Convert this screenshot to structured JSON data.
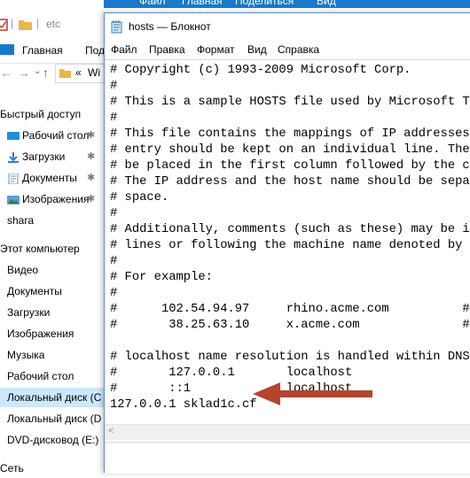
{
  "explorer": {
    "title_path": "etc",
    "ribbon_tabs": [
      "Файл",
      "Главная",
      "Поделиться",
      "Вид"
    ],
    "tabs": [
      "Главная",
      "Под"
    ],
    "address_fragment": "Wi",
    "address_prefix": "«",
    "nav": {
      "quick_access": "Быстрый доступ",
      "quick_items": [
        {
          "label": "Рабочий стол",
          "icon": "desktop-icon"
        },
        {
          "label": "Загрузки",
          "icon": "downloads-icon"
        },
        {
          "label": "Документы",
          "icon": "documents-icon"
        },
        {
          "label": "Изображения",
          "icon": "pictures-icon"
        },
        {
          "label": "shara",
          "icon": "folder-icon"
        }
      ],
      "this_pc": "Этот компьютер",
      "pc_items": [
        {
          "label": "Видео",
          "icon": "video-icon"
        },
        {
          "label": "Документы",
          "icon": "documents-icon"
        },
        {
          "label": "Загрузки",
          "icon": "downloads-icon"
        },
        {
          "label": "Изображения",
          "icon": "pictures-icon"
        },
        {
          "label": "Музыка",
          "icon": "music-icon"
        },
        {
          "label": "Рабочий стол",
          "icon": "desktop-icon"
        },
        {
          "label": "Локальный диск (C",
          "icon": "drive-icon"
        },
        {
          "label": "Локальный диск (D",
          "icon": "drive-icon"
        },
        {
          "label": "DVD-дисковод (E:)",
          "icon": "dvd-icon"
        }
      ],
      "network": "Сеть"
    }
  },
  "notepad": {
    "title": "hosts — Блокнот",
    "menu": [
      "Файл",
      "Правка",
      "Формат",
      "Вид",
      "Справка"
    ],
    "content": "# Copyright (c) 1993-2009 Microsoft Corp.\n#\n# This is a sample HOSTS file used by Microsoft TCP\n#\n# This file contains the mappings of IP addresses t\n# entry should be kept on an individual line. The I\n# be placed in the first column followed by the cor\n# The IP address and the host name should be separa\n# space.\n#\n# Additionally, comments (such as these) may be ins\n# lines or following the machine name denoted by a \n#\n# For example:\n#\n#      102.54.94.97     rhino.acme.com          # s\n#       38.25.63.10     x.acme.com              # x\n\n# localhost name resolution is handled within DNS i\n#       127.0.0.1       localhost\n#       ::1             localhost\n127.0.0.1 sklad1c.cf"
  },
  "colors": {
    "ribbon_blue": "#1979ca",
    "selection": "#cce8ff",
    "arrow": "#b5442c"
  }
}
